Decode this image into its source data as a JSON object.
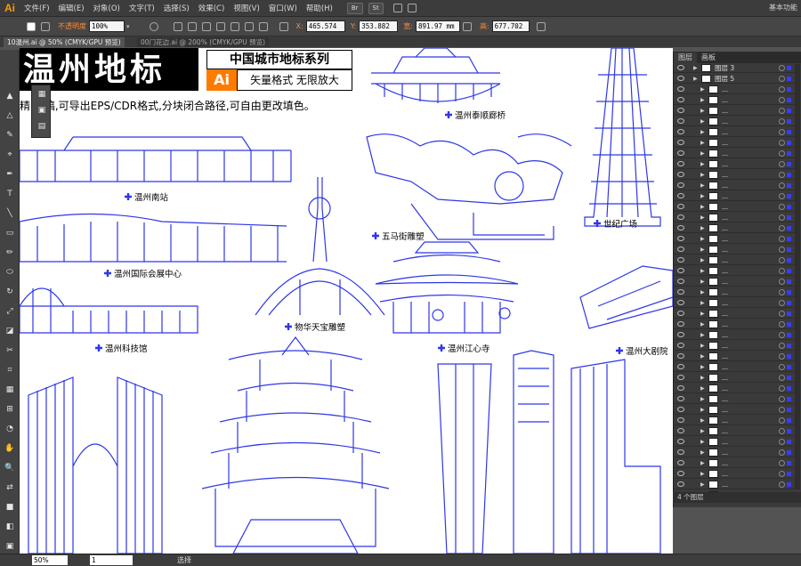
{
  "app": {
    "logo": "Ai",
    "workspace": "基本功能"
  },
  "menu": [
    "文件(F)",
    "编辑(E)",
    "对象(O)",
    "文字(T)",
    "选择(S)",
    "效果(C)",
    "视图(V)",
    "窗口(W)",
    "帮助(H)"
  ],
  "menu_buttons": [
    "Br",
    "St"
  ],
  "control": {
    "opacity_label": "不透明度",
    "opacity_value": "100%",
    "x_label": "X:",
    "x_value": "465.574",
    "y_label": "Y:",
    "y_value": "353.882",
    "w_label": "宽:",
    "w_value": "891.97 mm",
    "h_label": "高:",
    "h_value": "677.702"
  },
  "edit_group": "编组",
  "tabs": [
    {
      "label": "10温州.ai @ 50% (CMYK/GPU 预览)",
      "active": true
    },
    {
      "label": "00门花边.ai @ 200% (CMYK/GPU 预览)",
      "active": false
    }
  ],
  "artboard": {
    "title": "温州地标",
    "series": "中国城市地标系列",
    "ai_badge": "Ai",
    "vector": "矢量格式 无限放大",
    "description": "精    线稿,可导出EPS/CDR格式,分块闭合路径,可自由更改填色。"
  },
  "landmarks": {
    "taishun": "温州泰顺廊桥",
    "south_station": "温州南站",
    "expo": "温州国际会展中心",
    "wuhua": "物华天宝雕塑",
    "science": "温州科技馆",
    "wuma": "五马街雕塑",
    "century": "世纪广场",
    "jiangxin": "温州江心寺",
    "theater": "温州大剧院"
  },
  "layers_panel": {
    "tabs": [
      "图层",
      "画板"
    ],
    "layers": [
      {
        "name": "图层 3",
        "level": 0
      },
      {
        "name": "图层 5",
        "level": 0
      },
      {
        "name": "...",
        "level": 1
      },
      {
        "name": "...",
        "level": 1
      },
      {
        "name": "...",
        "level": 1
      },
      {
        "name": "...",
        "level": 1
      },
      {
        "name": "...",
        "level": 1
      },
      {
        "name": "...",
        "level": 1
      },
      {
        "name": "...",
        "level": 1
      },
      {
        "name": "...",
        "level": 1
      },
      {
        "name": "...",
        "level": 1
      },
      {
        "name": "...",
        "level": 1
      },
      {
        "name": "...",
        "level": 1
      },
      {
        "name": "...",
        "level": 1
      },
      {
        "name": "...",
        "level": 1
      },
      {
        "name": "...",
        "level": 1
      },
      {
        "name": "...",
        "level": 1
      },
      {
        "name": "...",
        "level": 1
      },
      {
        "name": "...",
        "level": 1
      },
      {
        "name": "...",
        "level": 1
      },
      {
        "name": "...",
        "level": 1
      },
      {
        "name": "...",
        "level": 1
      },
      {
        "name": "...",
        "level": 1
      },
      {
        "name": "...",
        "level": 1
      },
      {
        "name": "...",
        "level": 1
      },
      {
        "name": "...",
        "level": 1
      },
      {
        "name": "...",
        "level": 1
      },
      {
        "name": "...",
        "level": 1
      },
      {
        "name": "...",
        "level": 1
      },
      {
        "name": "...",
        "level": 1
      },
      {
        "name": "...",
        "level": 1
      },
      {
        "name": "...",
        "level": 1
      },
      {
        "name": "...",
        "level": 1
      },
      {
        "name": "...",
        "level": 1
      },
      {
        "name": "...",
        "level": 1
      },
      {
        "name": "...",
        "level": 1
      },
      {
        "name": "...",
        "level": 1
      },
      {
        "name": "...",
        "level": 1
      },
      {
        "name": "...",
        "level": 1
      },
      {
        "name": "...",
        "level": 1
      },
      {
        "name": "...",
        "level": 1
      }
    ],
    "footer": "4 个图层"
  },
  "status": {
    "zoom": "50%",
    "page": "1",
    "tool": "选择"
  },
  "colors": {
    "accent": "#ff7b00",
    "art": "#2e37e8",
    "panel": "#3a3a3a"
  }
}
